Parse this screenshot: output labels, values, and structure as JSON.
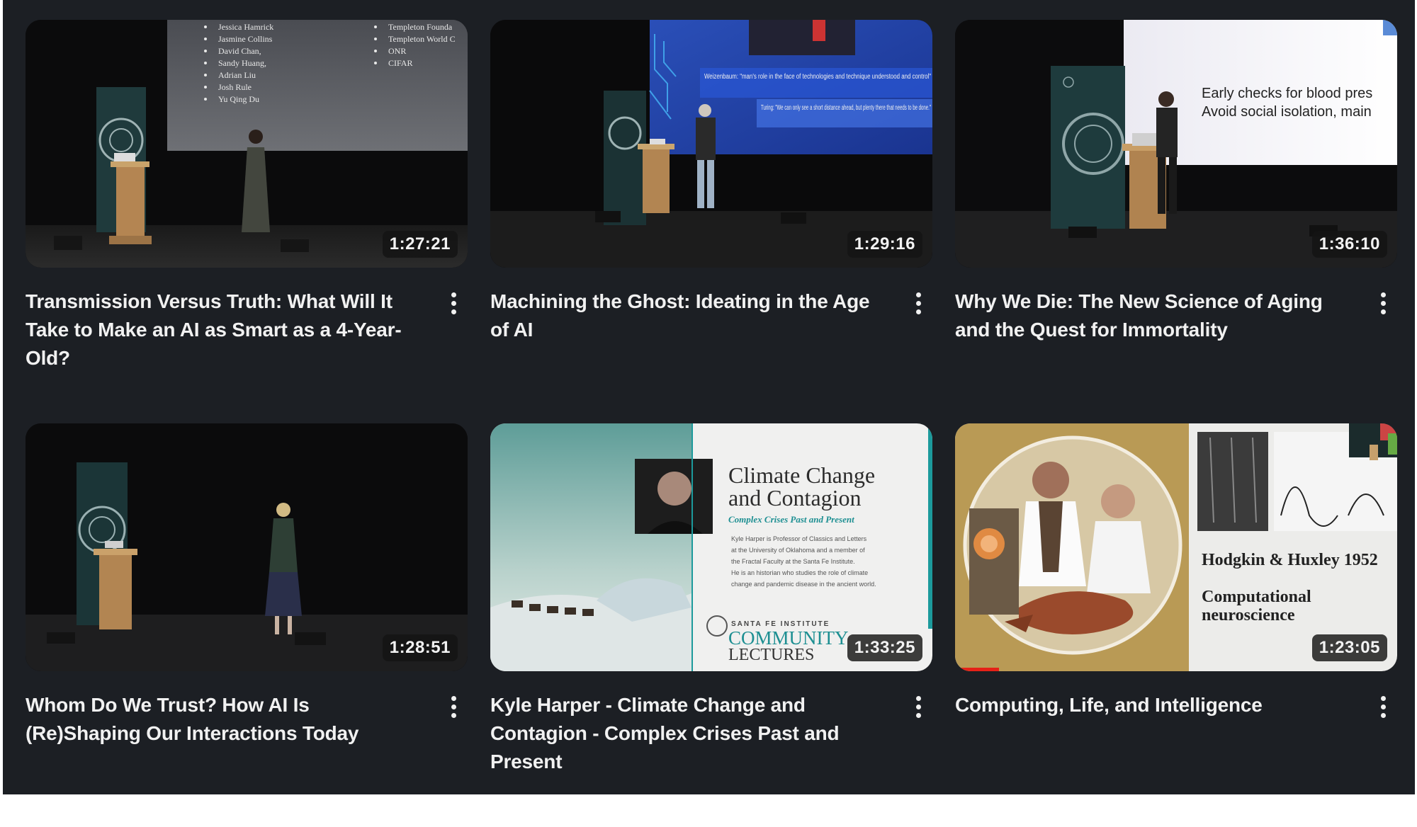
{
  "videos": [
    {
      "title": "Transmission Versus Truth: What Will It Take to Make an AI as Smart as a 4-Year-Old?",
      "duration": "1:27:21",
      "slide": {
        "names": [
          "Jessica Hamrick",
          "Jasmine Collins",
          "David Chan,",
          "Sandy Huang,",
          "Adrian Liu",
          "Josh Rule",
          "Yu Qing Du"
        ],
        "funders": [
          "Templeton Founda",
          "Templeton World C",
          "ONR",
          "CIFAR"
        ]
      }
    },
    {
      "title": "Machining the Ghost: Ideating in the Age of AI",
      "duration": "1:29:16",
      "slide": {
        "quote1": "Weizenbaum: \"man's role in the face of technologies and technique understood and control\"",
        "quote2": "Turing: \"We can only see a short distance ahead, but plenty there that needs to be done.\""
      }
    },
    {
      "title": "Why We Die: The New Science of Aging and the Quest for Immortality",
      "duration": "1:36:10",
      "slide": {
        "line1": "Early checks for blood pres",
        "line2": "Avoid social isolation, main"
      }
    },
    {
      "title": "Whom Do We Trust? How AI Is (Re)Shaping Our Interactions Today",
      "duration": "1:28:51",
      "slide": {}
    },
    {
      "title": "Kyle Harper - Climate Change and Contagion - Complex Crises Past and Present",
      "duration": "1:33:25",
      "slide": {
        "heading1": "Climate Change",
        "heading2": "and Contagion",
        "subheading": "Complex Crises Past and Present",
        "bio": [
          "Kyle Harper is Professor of Classics and Letters",
          "at the University of Oklahoma and a member of",
          "the Fractal Faculty at the Santa Fe Institute.",
          "He is an historian who studies the role of climate",
          "change and pandemic disease in the ancient world."
        ],
        "org": "SANTA FE INSTITUTE",
        "series1": "COMMUNITY",
        "series2": "LECTURES"
      }
    },
    {
      "title": "Computing, Life, and Intelligence",
      "duration": "1:23:05",
      "progress": 0.1,
      "slide": {
        "heading": "Hodgkin & Huxley 1952",
        "sub1": "Computational",
        "sub2": "neuroscience"
      }
    }
  ],
  "colors": {
    "background": "#1c1f24",
    "text": "#f1f1f1",
    "progress": "#e62117"
  },
  "icons": {
    "more": "more-vert-icon"
  }
}
